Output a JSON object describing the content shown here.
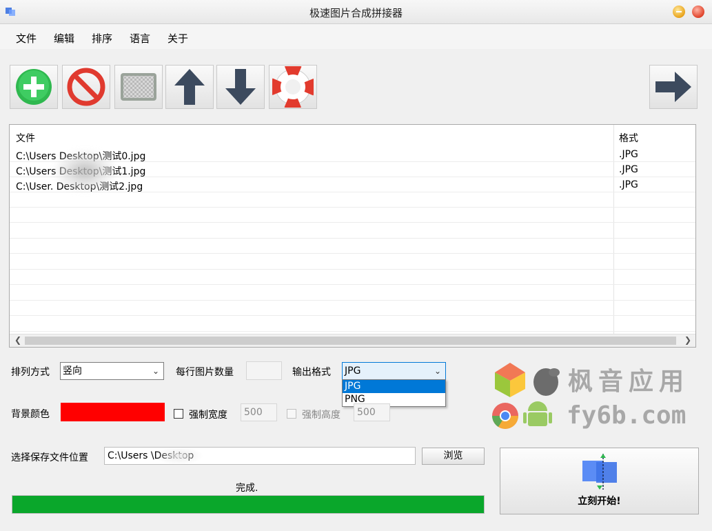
{
  "window": {
    "title": "极速图片合成拼接器"
  },
  "menu": [
    "文件",
    "编辑",
    "排序",
    "语言",
    "关于"
  ],
  "toolbar": {
    "buttons": [
      "add-icon",
      "remove-icon",
      "clear-icon",
      "move-up-icon",
      "move-down-icon",
      "help-icon",
      "next-icon"
    ]
  },
  "file_list": {
    "headers": {
      "file": "文件",
      "format": "格式"
    },
    "rows": [
      {
        "file": "C:\\Users             Desktop\\测试0.jpg",
        "format": ".JPG"
      },
      {
        "file": "C:\\Users             Desktop\\测试1.jpg",
        "format": ".JPG"
      },
      {
        "file": "C:\\User.             Desktop\\测试2.jpg",
        "format": ".JPG"
      }
    ]
  },
  "options": {
    "arrange_label": "排列方式",
    "arrange_value": "竖向",
    "per_row_label": "每行图片数量",
    "per_row_value": "",
    "output_format_label": "输出格式",
    "output_format_value": "JPG",
    "output_format_options": [
      "JPG",
      "PNG"
    ],
    "bg_color_label": "背景颜色",
    "bg_color": "#ff0000",
    "force_width_label": "强制宽度",
    "force_width_value": "500",
    "force_height_label": "强制高度",
    "force_height_value": "500"
  },
  "save": {
    "label": "选择保存文件位置",
    "path": "C:\\Users               \\Desktop",
    "browse_label": "浏览"
  },
  "status": {
    "text": "完成.",
    "progress": 1.0
  },
  "start_button": {
    "label": "立刻开始!"
  },
  "watermark": {
    "line1": "枫音应用",
    "line2": "fy6b.com"
  }
}
